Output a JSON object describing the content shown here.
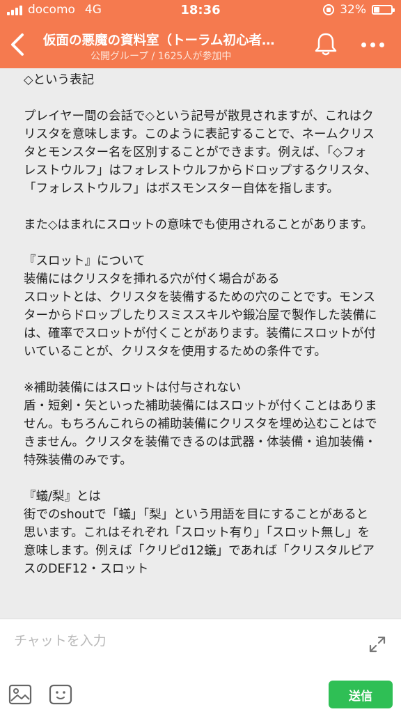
{
  "status_bar": {
    "carrier": "docomo",
    "network": "4G",
    "time": "18:36",
    "battery": "32%",
    "battery_level": 0.32
  },
  "header": {
    "title": "仮面の悪魔の資料室（トーラム初心者…",
    "subtitle": "公開グループ / 1625人が参加中",
    "icons": [
      "back-chevron-icon",
      "bell-icon",
      "more-dots-icon"
    ]
  },
  "post": {
    "paragraphs": [
      "◇という表記",
      "プレイヤー間の会話で◇という記号が散見されますが、これはクリスタを意味します。このように表記することで、ネームクリスタとモンスター名を区別することができます。例えば、「◇フォレストウルフ」はフォレストウルフからドロップするクリスタ、「フォレストウルフ」はボスモンスター自体を指します。",
      "また◇はまれにスロットの意味でも使用されることがあります。",
      "『スロット』について\n装備にはクリスタを挿れる穴が付く場合がある\nスロットとは、クリスタを装備するための穴のことです。モンスターからドロップしたりスミススキルや鍛冶屋で製作した装備には、確率でスロットが付くことがあります。装備にスロットが付いていることが、クリスタを使用するための条件です。",
      "※補助装備にはスロットは付与されない\n盾・短剣・矢といった補助装備にはスロットが付くことはありません。もちろんこれらの補助装備にクリスタを埋め込むことはできません。クリスタを装備できるのは武器・体装備・追加装備・特殊装備のみです。",
      "『蟻/梨』とは\n街でのshoutで「蟻」「梨」という用語を目にすることがあると思います。これはそれぞれ「スロット有り」「スロット無し」を意味します。例えば「クリピd12蟻」であれば「クリスタルピアスのDEF12・スロット"
    ]
  },
  "composer": {
    "placeholder": "チャットを入力",
    "send_label": "送信",
    "icons": [
      "expand-icon",
      "image-icon",
      "sticker-icon"
    ]
  }
}
